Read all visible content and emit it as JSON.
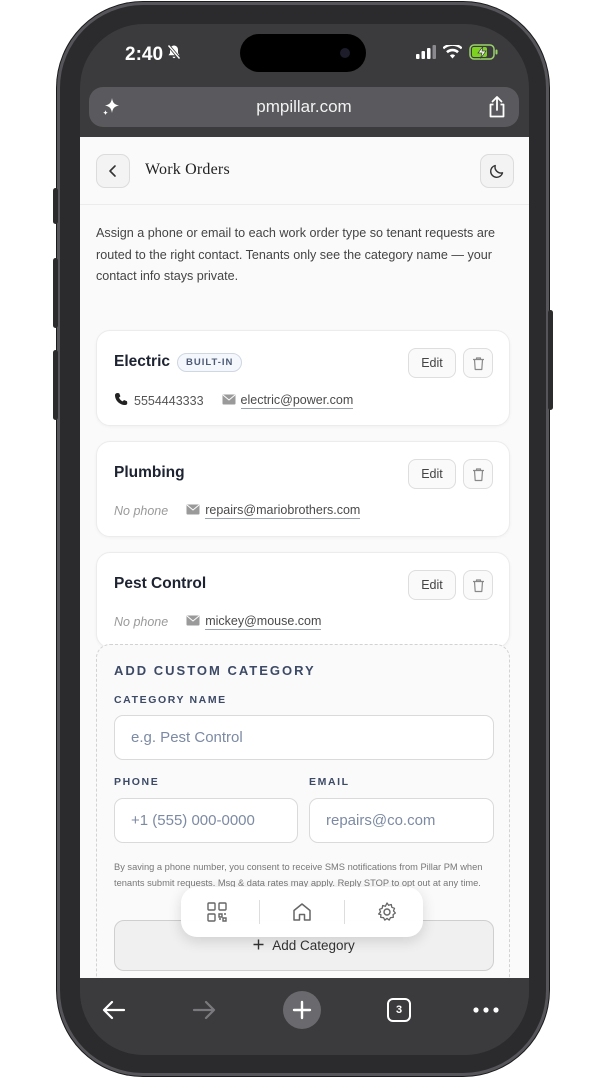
{
  "status_bar": {
    "time": "2:40"
  },
  "browser": {
    "url": "pmpillar.com",
    "tab_count": "3"
  },
  "header": {
    "title": "Work Orders"
  },
  "intro_text": "Assign a phone or email to each work order type so tenant requests are routed to the right contact. Tenants only see the category name — your contact info stays private.",
  "categories": [
    {
      "name": "Electric",
      "badge": "BUILT-IN",
      "phone": "5554443333",
      "email": "electric@power.com",
      "edit_label": "Edit"
    },
    {
      "name": "Plumbing",
      "phone": "No phone",
      "email": "repairs@mariobrothers.com",
      "edit_label": "Edit"
    },
    {
      "name": "Pest Control",
      "phone": "No phone",
      "email": "mickey@mouse.com",
      "edit_label": "Edit"
    }
  ],
  "add_form": {
    "heading": "ADD CUSTOM CATEGORY",
    "category_label": "CATEGORY NAME",
    "category_placeholder": "e.g. Pest Control",
    "phone_label": "PHONE",
    "phone_placeholder": "+1 (555) 000-0000",
    "email_label": "EMAIL",
    "email_placeholder": "repairs@co.com",
    "consent": "By saving a phone number, you consent to receive SMS notifications from Pillar PM when tenants submit requests. Msg & data rates may apply. Reply STOP to opt out at any time.",
    "add_button": "Add Category"
  },
  "floating_nav": {
    "icons": [
      "qr-code-icon",
      "home-icon",
      "gear-icon"
    ]
  },
  "colors": {
    "accent_text": "#3d4a66",
    "placeholder": "#7c8aa3",
    "browser_chrome": "#3b3b3d"
  }
}
